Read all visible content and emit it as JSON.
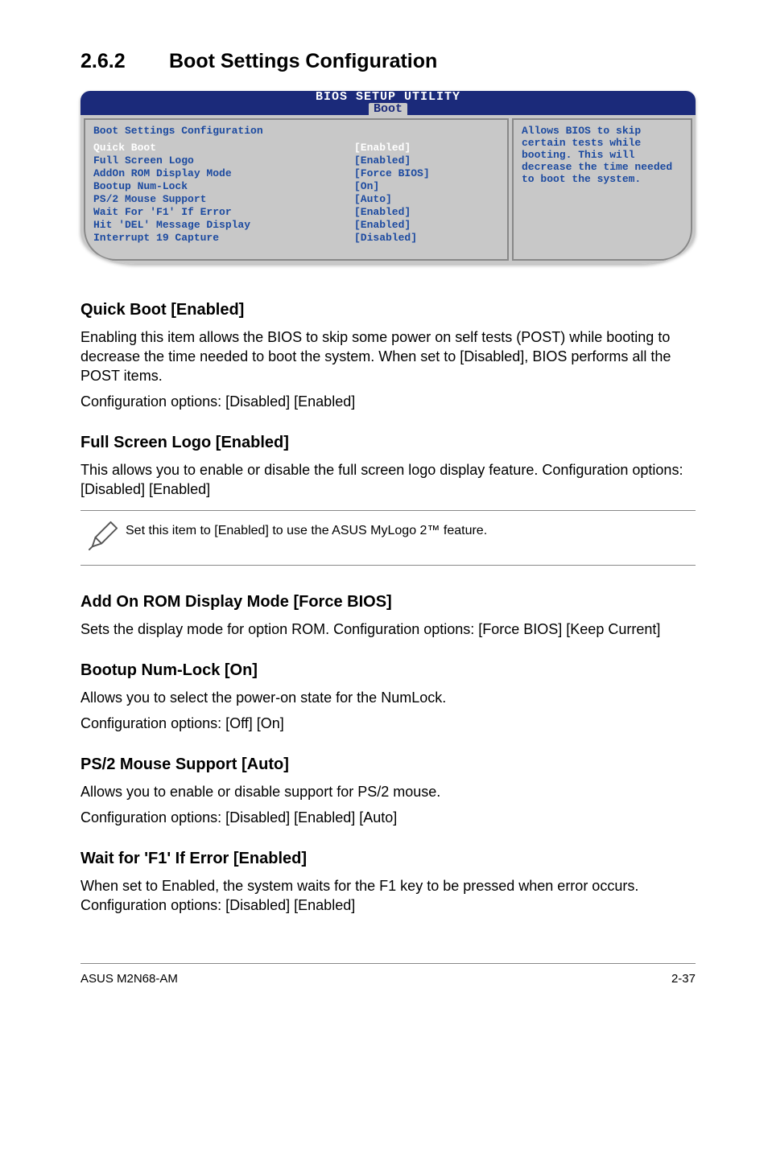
{
  "section": {
    "number": "2.6.2",
    "title": "Boot Settings Configuration"
  },
  "bios": {
    "titlebar_line1": "BIOS SETUP UTILITY",
    "titlebar_tab": "Boot",
    "panel_title": "Boot Settings Configuration",
    "rows": [
      {
        "label": "Quick Boot",
        "value": "[Enabled]",
        "selected": true
      },
      {
        "label": "Full Screen Logo",
        "value": "[Enabled]",
        "selected": false
      },
      {
        "label": "AddOn ROM Display Mode",
        "value": "[Force BIOS]",
        "selected": false
      },
      {
        "label": "Bootup Num-Lock",
        "value": "[On]",
        "selected": false
      },
      {
        "label": "PS/2 Mouse Support",
        "value": "[Auto]",
        "selected": false
      },
      {
        "label": "Wait For 'F1' If Error",
        "value": "[Enabled]",
        "selected": false
      },
      {
        "label": "Hit 'DEL' Message Display",
        "value": "[Enabled]",
        "selected": false
      },
      {
        "label": "Interrupt 19 Capture",
        "value": "[Disabled]",
        "selected": false
      }
    ],
    "help_text": "Allows BIOS to skip certain tests while booting. This will decrease the time needed to boot the system."
  },
  "items": {
    "quickboot": {
      "heading": "Quick Boot [Enabled]",
      "p1": "Enabling this item allows the BIOS to skip some power on self tests (POST) while booting to decrease the time needed to boot the system. When set to [Disabled], BIOS performs all the POST items.",
      "p2": "Configuration options: [Disabled] [Enabled]"
    },
    "fullscreen": {
      "heading": "Full Screen Logo [Enabled]",
      "p1": "This allows you to enable or disable the full screen logo display feature. Configuration options: [Disabled] [Enabled]"
    },
    "note": "Set this item to [Enabled] to use the ASUS MyLogo 2™ feature.",
    "addon": {
      "heading": "Add On ROM Display Mode [Force BIOS]",
      "p1": "Sets the display mode for option ROM. Configuration options: [Force BIOS] [Keep Current]"
    },
    "numlock": {
      "heading": "Bootup Num-Lock [On]",
      "p1": "Allows you to select the power-on state for the NumLock.",
      "p2": "Configuration options: [Off] [On]"
    },
    "ps2": {
      "heading": "PS/2 Mouse Support [Auto]",
      "p1": "Allows you to enable or disable support for PS/2 mouse.",
      "p2": "Configuration options: [Disabled] [Enabled] [Auto]"
    },
    "waitf1": {
      "heading": "Wait for 'F1' If Error [Enabled]",
      "p1": "When set to Enabled, the system waits for the F1 key to be pressed when error occurs. Configuration options: [Disabled] [Enabled]"
    }
  },
  "footer": {
    "left": "ASUS M2N68-AM",
    "right": "2-37"
  }
}
